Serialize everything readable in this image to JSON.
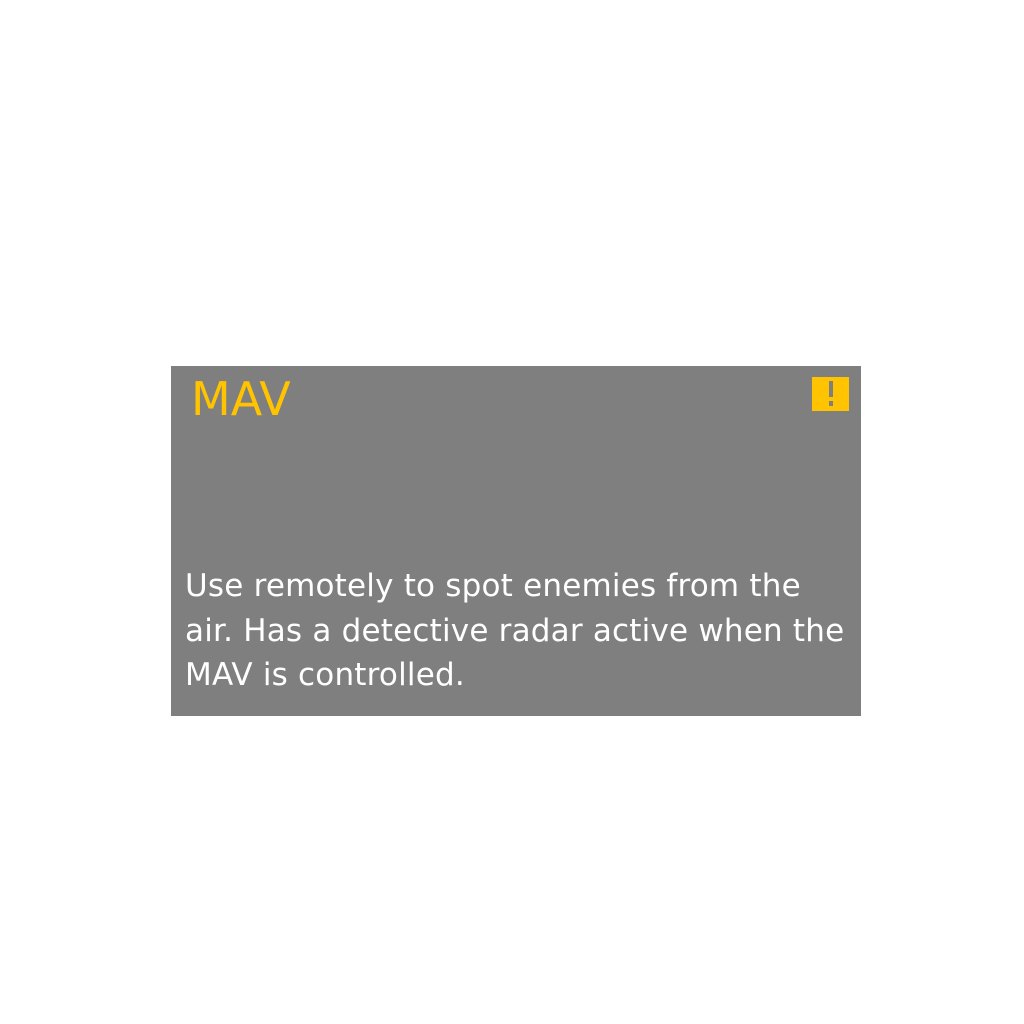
{
  "item_card": {
    "title": "MAV",
    "description": "Use remotely to spot enemies from the\nair. Has a detective radar active when the\nMAV is controlled.",
    "alert_icon": "exclamation-icon",
    "colors": {
      "card_background": "#7f7f7f",
      "accent": "#ffc300",
      "description_text": "#ffffff",
      "page_background": "#ffffff"
    }
  }
}
